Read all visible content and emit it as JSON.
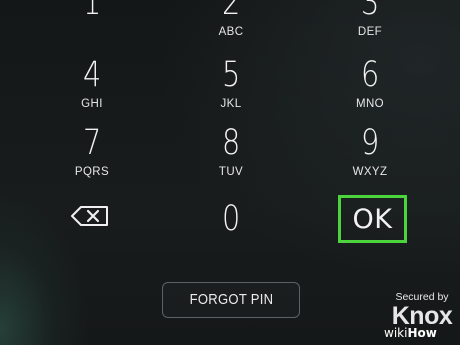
{
  "keypad": {
    "keys": [
      {
        "digit": "1",
        "letters": ""
      },
      {
        "digit": "2",
        "letters": "ABC"
      },
      {
        "digit": "3",
        "letters": "DEF"
      },
      {
        "digit": "4",
        "letters": "GHI"
      },
      {
        "digit": "5",
        "letters": "JKL"
      },
      {
        "digit": "6",
        "letters": "MNO"
      },
      {
        "digit": "7",
        "letters": "PQRS"
      },
      {
        "digit": "8",
        "letters": "TUV"
      },
      {
        "digit": "9",
        "letters": "WXYZ"
      },
      {
        "digit": "0",
        "letters": ""
      }
    ],
    "backspace_icon": "backspace-icon",
    "ok_label": "OK",
    "ok_highlight_color": "#4cd43c"
  },
  "forgot_pin": {
    "label": "FORGOT PIN"
  },
  "security": {
    "secured_by": "Secured by",
    "brand": "Knox"
  },
  "watermark": {
    "part1": "wiki",
    "part2": "How"
  }
}
